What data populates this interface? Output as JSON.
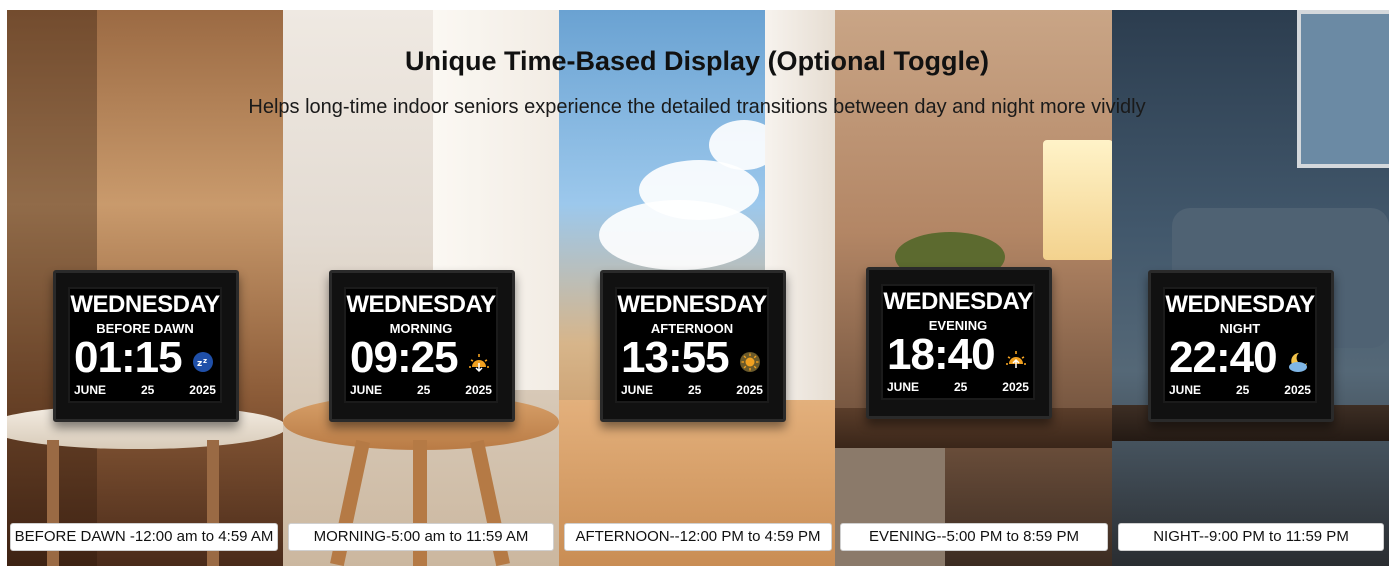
{
  "header": {
    "title": "Unique Time-Based Display (Optional Toggle)",
    "subtitle": "Helps long-time indoor seniors experience the detailed transitions between day and night more vividly"
  },
  "panels": [
    {
      "day": "WEDNESDAY",
      "period": "BEFORE DAWN",
      "time": "01:15",
      "icon": "sleep-zz-icon",
      "month": "JUNE",
      "date": "25",
      "year": "2025",
      "caption": "BEFORE DAWN -12:00 am to 4:59 AM"
    },
    {
      "day": "WEDNESDAY",
      "period": "MORNING",
      "time": "09:25",
      "icon": "sunrise-icon",
      "month": "JUNE",
      "date": "25",
      "year": "2025",
      "caption": "MORNING-5:00 am to 11:59 AM"
    },
    {
      "day": "WEDNESDAY",
      "period": "AFTERNOON",
      "time": "13:55",
      "icon": "sun-icon",
      "month": "JUNE",
      "date": "25",
      "year": "2025",
      "caption": "AFTERNOON--12:00 PM to 4:59 PM"
    },
    {
      "day": "WEDNESDAY",
      "period": "EVENING",
      "time": "18:40",
      "icon": "sunset-icon",
      "month": "JUNE",
      "date": "25",
      "year": "2025",
      "caption": "EVENING--5:00 PM to 8:59 PM"
    },
    {
      "day": "WEDNESDAY",
      "period": "NIGHT",
      "time": "22:40",
      "icon": "moon-cloud-icon",
      "month": "JUNE",
      "date": "25",
      "year": "2025",
      "caption": "NIGHT--9:00 PM to 11:59 PM"
    }
  ],
  "colors": {
    "clock_face": "#000000",
    "clock_text": "#ffffff",
    "sleep_icon": "#1f4fa8",
    "sun_icon": "#f0a020",
    "moon_icon": "#f2c24a",
    "cloud_icon": "#7fb6e6"
  }
}
